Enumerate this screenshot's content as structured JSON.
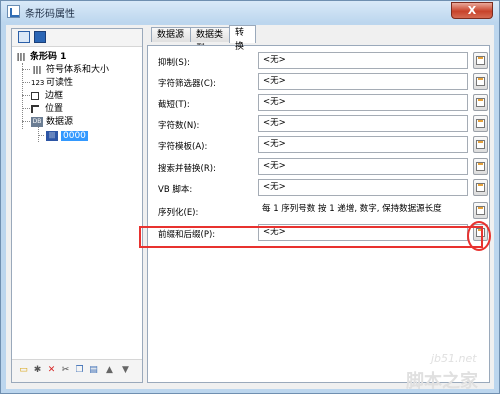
{
  "window": {
    "title": "条形码属性",
    "close_label": "X"
  },
  "tree": {
    "root": "条形码 1",
    "items": [
      "符号体系和大小",
      "可读性",
      "边框",
      "位置",
      "数据源"
    ],
    "readability_prefix": "123",
    "child": "0000"
  },
  "tabs": [
    "数据源",
    "数据类型",
    "转换"
  ],
  "active_tab": "转换",
  "fields": [
    {
      "label": "抑制(S):",
      "value": "<无>"
    },
    {
      "label": "字符筛选器(C):",
      "value": "<无>"
    },
    {
      "label": "截短(T):",
      "value": "<无>"
    },
    {
      "label": "字符数(N):",
      "value": "<无>"
    },
    {
      "label": "字符模板(A):",
      "value": "<无>"
    },
    {
      "label": "搜索并替换(R):",
      "value": "<无>"
    },
    {
      "label": "VB 脚本:",
      "value": "<无>"
    },
    {
      "label": "序列化(E):",
      "value": "每 1 序列号数 按 1 递增, 数字, 保持数据源长度"
    },
    {
      "label": "前缀和后缀(P):",
      "value": "<无>"
    }
  ],
  "watermark": {
    "line1": "jb51.net",
    "line2": "脚本之家"
  },
  "colors": {
    "highlight": "#e8322f",
    "selection": "#3399ff"
  }
}
